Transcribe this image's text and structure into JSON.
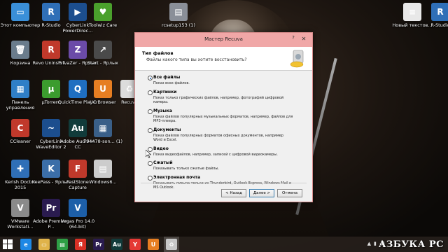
{
  "desktop_icons": [
    {
      "name": "icon-this-computer",
      "label": "Этот компьютер",
      "glyph": "▭",
      "color": "#3a8fd8"
    },
    {
      "name": "icon-r-studio",
      "label": "R-Studio",
      "glyph": "R",
      "color": "#2f6fb7"
    },
    {
      "name": "icon-cyberlink-powerdirector",
      "label": "CyberLink PowerDirec...",
      "glyph": "▶",
      "color": "#1c4e8e"
    },
    {
      "name": "icon-toolwiz-care",
      "label": "Toolwiz Care",
      "glyph": "♥",
      "color": "#4aa02c"
    },
    {
      "name": "icon-rcsetup",
      "label": "rcsetup153 (1)",
      "glyph": "▤",
      "color": "#8a8f98"
    },
    {
      "name": "icon-new-text",
      "label": "Новый текстов...",
      "glyph": "≡",
      "color": "#e8e8e8"
    },
    {
      "name": "icon-r-studio-2",
      "label": "R-Studio",
      "glyph": "R",
      "color": "#2f6fb7"
    },
    {
      "name": "icon-recycle-bin",
      "label": "Корзина",
      "glyph": "🗑",
      "color": "#6a7c8c"
    },
    {
      "name": "icon-revo-uninstaller",
      "label": "Revo Uninstall...",
      "glyph": "R",
      "color": "#c0392b"
    },
    {
      "name": "icon-privazer",
      "label": "PrivaZer - Ярлык",
      "glyph": "Z",
      "color": "#6b4ba8"
    },
    {
      "name": "icon-start",
      "label": "Start - Ярлык",
      "glyph": "↗",
      "color": "#4a4a4a"
    },
    {
      "name": "icon-control-panel",
      "label": "Панель управления",
      "glyph": "▦",
      "color": "#2f7fc7"
    },
    {
      "name": "icon-utorrent",
      "label": "µTorrent",
      "glyph": "µ",
      "color": "#3b9c2e"
    },
    {
      "name": "icon-quicktime",
      "label": "QuickTime Player",
      "glyph": "Q",
      "color": "#1f6fc1"
    },
    {
      "name": "icon-uc-browser",
      "label": "UC Browser",
      "glyph": "U",
      "color": "#e67e22"
    },
    {
      "name": "icon-recuva",
      "label": "Recuva",
      "glyph": "♻",
      "color": "#dcdcdc"
    },
    {
      "name": "icon-ccleaner",
      "label": "CCleaner",
      "glyph": "C",
      "color": "#c0392b"
    },
    {
      "name": "icon-cyberlink-wavedirector",
      "label": "CyberLink WaveEditor 2",
      "glyph": "~",
      "color": "#1c4e8e"
    },
    {
      "name": "icon-adobe-audition",
      "label": "Adobe Audition CC",
      "glyph": "Au",
      "color": "#113b3a"
    },
    {
      "name": "icon-file-794478",
      "label": "794478-son... (1)",
      "glyph": "▦",
      "color": "#3a5f88"
    },
    {
      "name": "icon-kerish-doctor",
      "label": "Kerish Doctor 2015",
      "glyph": "✚",
      "color": "#2f6fb7"
    },
    {
      "name": "icon-keepass",
      "label": "KeePass - Ярлык",
      "glyph": "K",
      "color": "#3b6ea8"
    },
    {
      "name": "icon-faststone-capture",
      "label": "FastStone Capture",
      "glyph": "F",
      "color": "#c0392b"
    },
    {
      "name": "icon-windows6",
      "label": "Windows6...",
      "glyph": "▤",
      "color": "#cccccc"
    },
    {
      "name": "icon-vmware",
      "label": "VMware Workstati...",
      "glyph": "V",
      "color": "#8a8a8a"
    },
    {
      "name": "icon-adobe-premiere",
      "label": "Adobe Premiere P...",
      "glyph": "Pr",
      "color": "#2a1b4f"
    },
    {
      "name": "icon-vegas-pro",
      "label": "Vegas Pro 14.0 (64-bit)",
      "glyph": "V",
      "color": "#1d5fa8"
    }
  ],
  "dialog": {
    "title": "Мастер Recuva",
    "help": "?",
    "close": "✕",
    "header_title": "Тип файлов",
    "header_subtitle": "Файлы какого типа вы хотите восстановить?",
    "options": [
      {
        "title": "Все файлы",
        "desc": "Показ всех файлов.",
        "selected": true
      },
      {
        "title": "Картинки",
        "desc": "Показ только графических файлов, например, фотографий цифровой камеры.",
        "selected": false
      },
      {
        "title": "Музыка",
        "desc": "Показ файлов популярных музыкальных форматов, например, файлов для MP3-плеера.",
        "selected": false
      },
      {
        "title": "Документы",
        "desc": "Показ файлов популярных форматов офисных документов, например Word и Excel.",
        "selected": false
      },
      {
        "title": "Видео",
        "desc": "Показ видеофайлов, например, записей с цифровой видеокамеры.",
        "selected": false
      },
      {
        "title": "Сжатый",
        "desc": "Показывать только сжатые файлы.",
        "selected": false
      },
      {
        "title": "Электронная почта",
        "desc": "Показывать письма только из Thunderbird, Outlook Express, Windows Mail и MS Outlook.",
        "selected": false
      }
    ],
    "buttons": {
      "back": "< Назад",
      "next": "Далее >",
      "cancel": "Отмена"
    }
  },
  "taskbar": {
    "items": [
      {
        "name": "taskbar-ie",
        "glyph": "e",
        "color": "#1e88e5",
        "active": false
      },
      {
        "name": "taskbar-explorer",
        "glyph": "▭",
        "color": "#e0b34a",
        "active": false
      },
      {
        "name": "taskbar-store",
        "glyph": "▤",
        "color": "#2e9e45",
        "active": false
      },
      {
        "name": "taskbar-yandex",
        "glyph": "Я",
        "color": "#d93025",
        "active": false
      },
      {
        "name": "taskbar-premiere",
        "glyph": "Pr",
        "color": "#2a1b4f",
        "active": false
      },
      {
        "name": "taskbar-audition",
        "glyph": "Au",
        "color": "#113b3a",
        "active": false
      },
      {
        "name": "taskbar-yandex-browser",
        "glyph": "Y",
        "color": "#e53935",
        "active": false
      },
      {
        "name": "taskbar-uc",
        "glyph": "U",
        "color": "#e67e22",
        "active": false
      },
      {
        "name": "taskbar-recuva",
        "glyph": "♻",
        "color": "#c8c8c8",
        "active": true
      }
    ],
    "watermark": "АЗБУКА PC"
  }
}
